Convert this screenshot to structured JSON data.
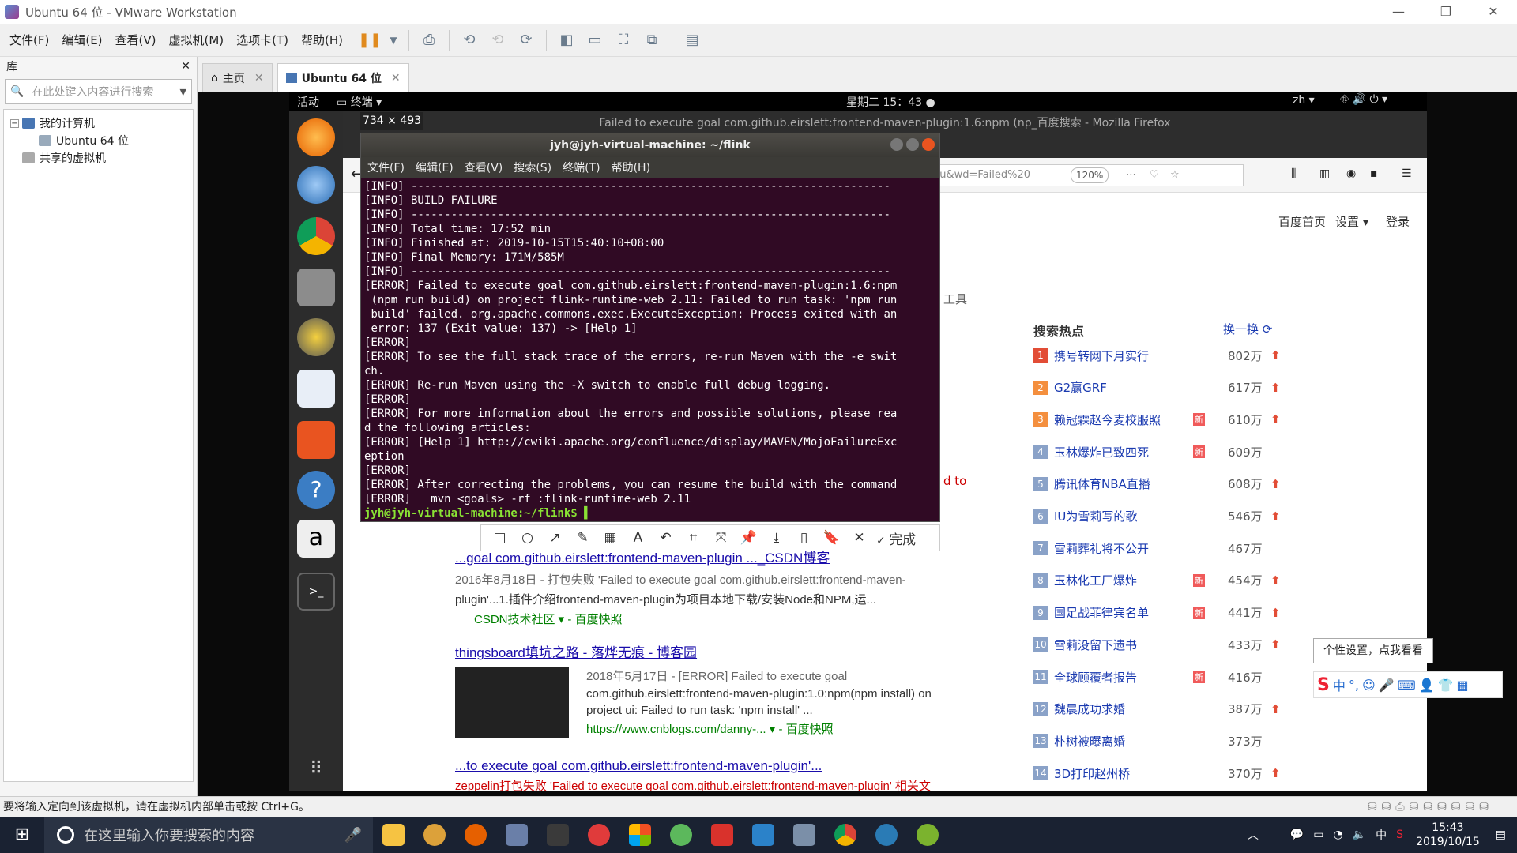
{
  "window": {
    "title": "Ubuntu 64 位 - VMware Workstation",
    "min": "—",
    "max": "❐",
    "close": "✕"
  },
  "vm_menu": [
    "文件(F)",
    "编辑(E)",
    "查看(V)",
    "虚拟机(M)",
    "选项卡(T)",
    "帮助(H)"
  ],
  "library": {
    "title": "库",
    "close": "✕",
    "search_placeholder": "在此处键入内容进行搜索",
    "tree": {
      "my_computer": "我的计算机",
      "vm": "Ubuntu 64 位",
      "shared": "共享的虚拟机"
    }
  },
  "tabs": [
    {
      "label": "主页"
    },
    {
      "label": "Ubuntu 64 位"
    }
  ],
  "gnome": {
    "activities": "活动",
    "app": "终端 ▾",
    "clock": "星期二 15：43 ●",
    "lang": "zh ▾"
  },
  "firefox": {
    "title": "Failed to execute goal com.github.eirslett:frontend-maven-plugin:1.6:npm (np_百度搜索 - Mozilla Firefox",
    "url": "du&wd=Failed%20",
    "zoom": "120%",
    "baidu_links": [
      "百度首页",
      "设置 ▾",
      "登录"
    ],
    "snippet_right": "工具",
    "snippet_to": "d to",
    "hot": {
      "title": "搜索热点",
      "refresh": "换一换",
      "items": [
        {
          "rank": "1",
          "title": "携号转网下月实行",
          "count": "802万",
          "new": "",
          "up": "⬆"
        },
        {
          "rank": "2",
          "title": "G2赢GRF",
          "count": "617万",
          "new": "",
          "up": "⬆"
        },
        {
          "rank": "3",
          "title": "赖冠霖赵今麦校服照",
          "count": "610万",
          "new": "新",
          "up": "⬆"
        },
        {
          "rank": "4",
          "title": "玉林爆炸已致四死",
          "count": "609万",
          "new": "新",
          "up": ""
        },
        {
          "rank": "5",
          "title": "腾讯体育NBA直播",
          "count": "608万",
          "new": "",
          "up": "⬆"
        },
        {
          "rank": "6",
          "title": "IU为雪莉写的歌",
          "count": "546万",
          "new": "",
          "up": "⬆"
        },
        {
          "rank": "7",
          "title": "雪莉葬礼将不公开",
          "count": "467万",
          "new": "",
          "up": ""
        },
        {
          "rank": "8",
          "title": "玉林化工厂爆炸",
          "count": "454万",
          "new": "新",
          "up": "⬆"
        },
        {
          "rank": "9",
          "title": "国足战菲律宾名单",
          "count": "441万",
          "new": "新",
          "up": "⬆"
        },
        {
          "rank": "10",
          "title": "雪莉没留下遗书",
          "count": "433万",
          "new": "",
          "up": "⬆"
        },
        {
          "rank": "11",
          "title": "全球顾覆者报告",
          "count": "416万",
          "new": "新",
          "up": ""
        },
        {
          "rank": "12",
          "title": "魏晨成功求婚",
          "count": "387万",
          "new": "",
          "up": "⬆"
        },
        {
          "rank": "13",
          "title": "朴树被曝离婚",
          "count": "373万",
          "new": "",
          "up": ""
        },
        {
          "rank": "14",
          "title": "3D打印赵州桥",
          "count": "370万",
          "new": "",
          "up": "⬆"
        }
      ]
    },
    "results": [
      {
        "title": "...goal com.github.eirslett:frontend-maven-plugin ..._CSDN博客",
        "meta": "2016年8月18日 - 打包失败 'Failed to execute goal com.github.eirslett:frontend-maven-",
        "body": "plugin'...1.插件介绍frontend-maven-plugin为项目本地下载/安装Node和NPM,运...",
        "source": "CSDN技术社区 ▾ - 百度快照"
      },
      {
        "title": "thingsboard填坑之路 - 落烨无痕 - 博客园",
        "meta": "2018年5月17日 - [ERROR] Failed to execute goal",
        "body1": "com.github.eirslett:frontend-maven-plugin:1.0:npm(npm install) on",
        "body2": "project ui: Failed to run task: 'npm install' ...",
        "source": "https://www.cnblogs.com/danny-... ▾ - 百度快照"
      },
      {
        "title": "...to execute goal com.github.eirslett:frontend-maven-plugin'...",
        "meta": "zeppelin打包失败 'Failed to execute goal com.github.eirslett:frontend-maven-plugin' 相关文"
      }
    ]
  },
  "terminal": {
    "title": "jyh@jyh-virtual-machine: ~/flink",
    "menu": [
      "文件(F)",
      "编辑(E)",
      "查看(V)",
      "搜索(S)",
      "终端(T)",
      "帮助(H)"
    ],
    "output": "[INFO] ------------------------------------------------------------------------\n[INFO] BUILD FAILURE\n[INFO] ------------------------------------------------------------------------\n[INFO] Total time: 17:52 min\n[INFO] Finished at: 2019-10-15T15:40:10+08:00\n[INFO] Final Memory: 171M/585M\n[INFO] ------------------------------------------------------------------------\n[ERROR] Failed to execute goal com.github.eirslett:frontend-maven-plugin:1.6:npm\n (npm run build) on project flink-runtime-web_2.11: Failed to run task: 'npm run\n build' failed. org.apache.commons.exec.ExecuteException: Process exited with an\n error: 137 (Exit value: 137) -> [Help 1]\n[ERROR]\n[ERROR] To see the full stack trace of the errors, re-run Maven with the -e swit\nch.\n[ERROR] Re-run Maven using the -X switch to enable full debug logging.\n[ERROR]\n[ERROR] For more information about the errors and possible solutions, please rea\nd the following articles:\n[ERROR] [Help 1] http://cwiki.apache.org/confluence/display/MAVEN/MojoFailureExc\neption\n[ERROR]\n[ERROR] After correcting the problems, you can resume the build with the command\n[ERROR]   mvn <goals> -rf :flink-runtime-web_2.11",
    "prompt": "jyh@jyh-virtual-machine:~/flink$ ▌"
  },
  "snip": {
    "size": "734 × 493",
    "done": "完成"
  },
  "tooltip": "个性设置，点我看看",
  "ime": {
    "lang": "中"
  },
  "status_bar": "要将输入定向到该虚拟机，请在虚拟机内部单击或按 Ctrl+G。",
  "taskbar": {
    "search_placeholder": "在这里输入你要搜索的内容",
    "ime_lang": "中",
    "time": "15:43",
    "date": "2019/10/15"
  }
}
